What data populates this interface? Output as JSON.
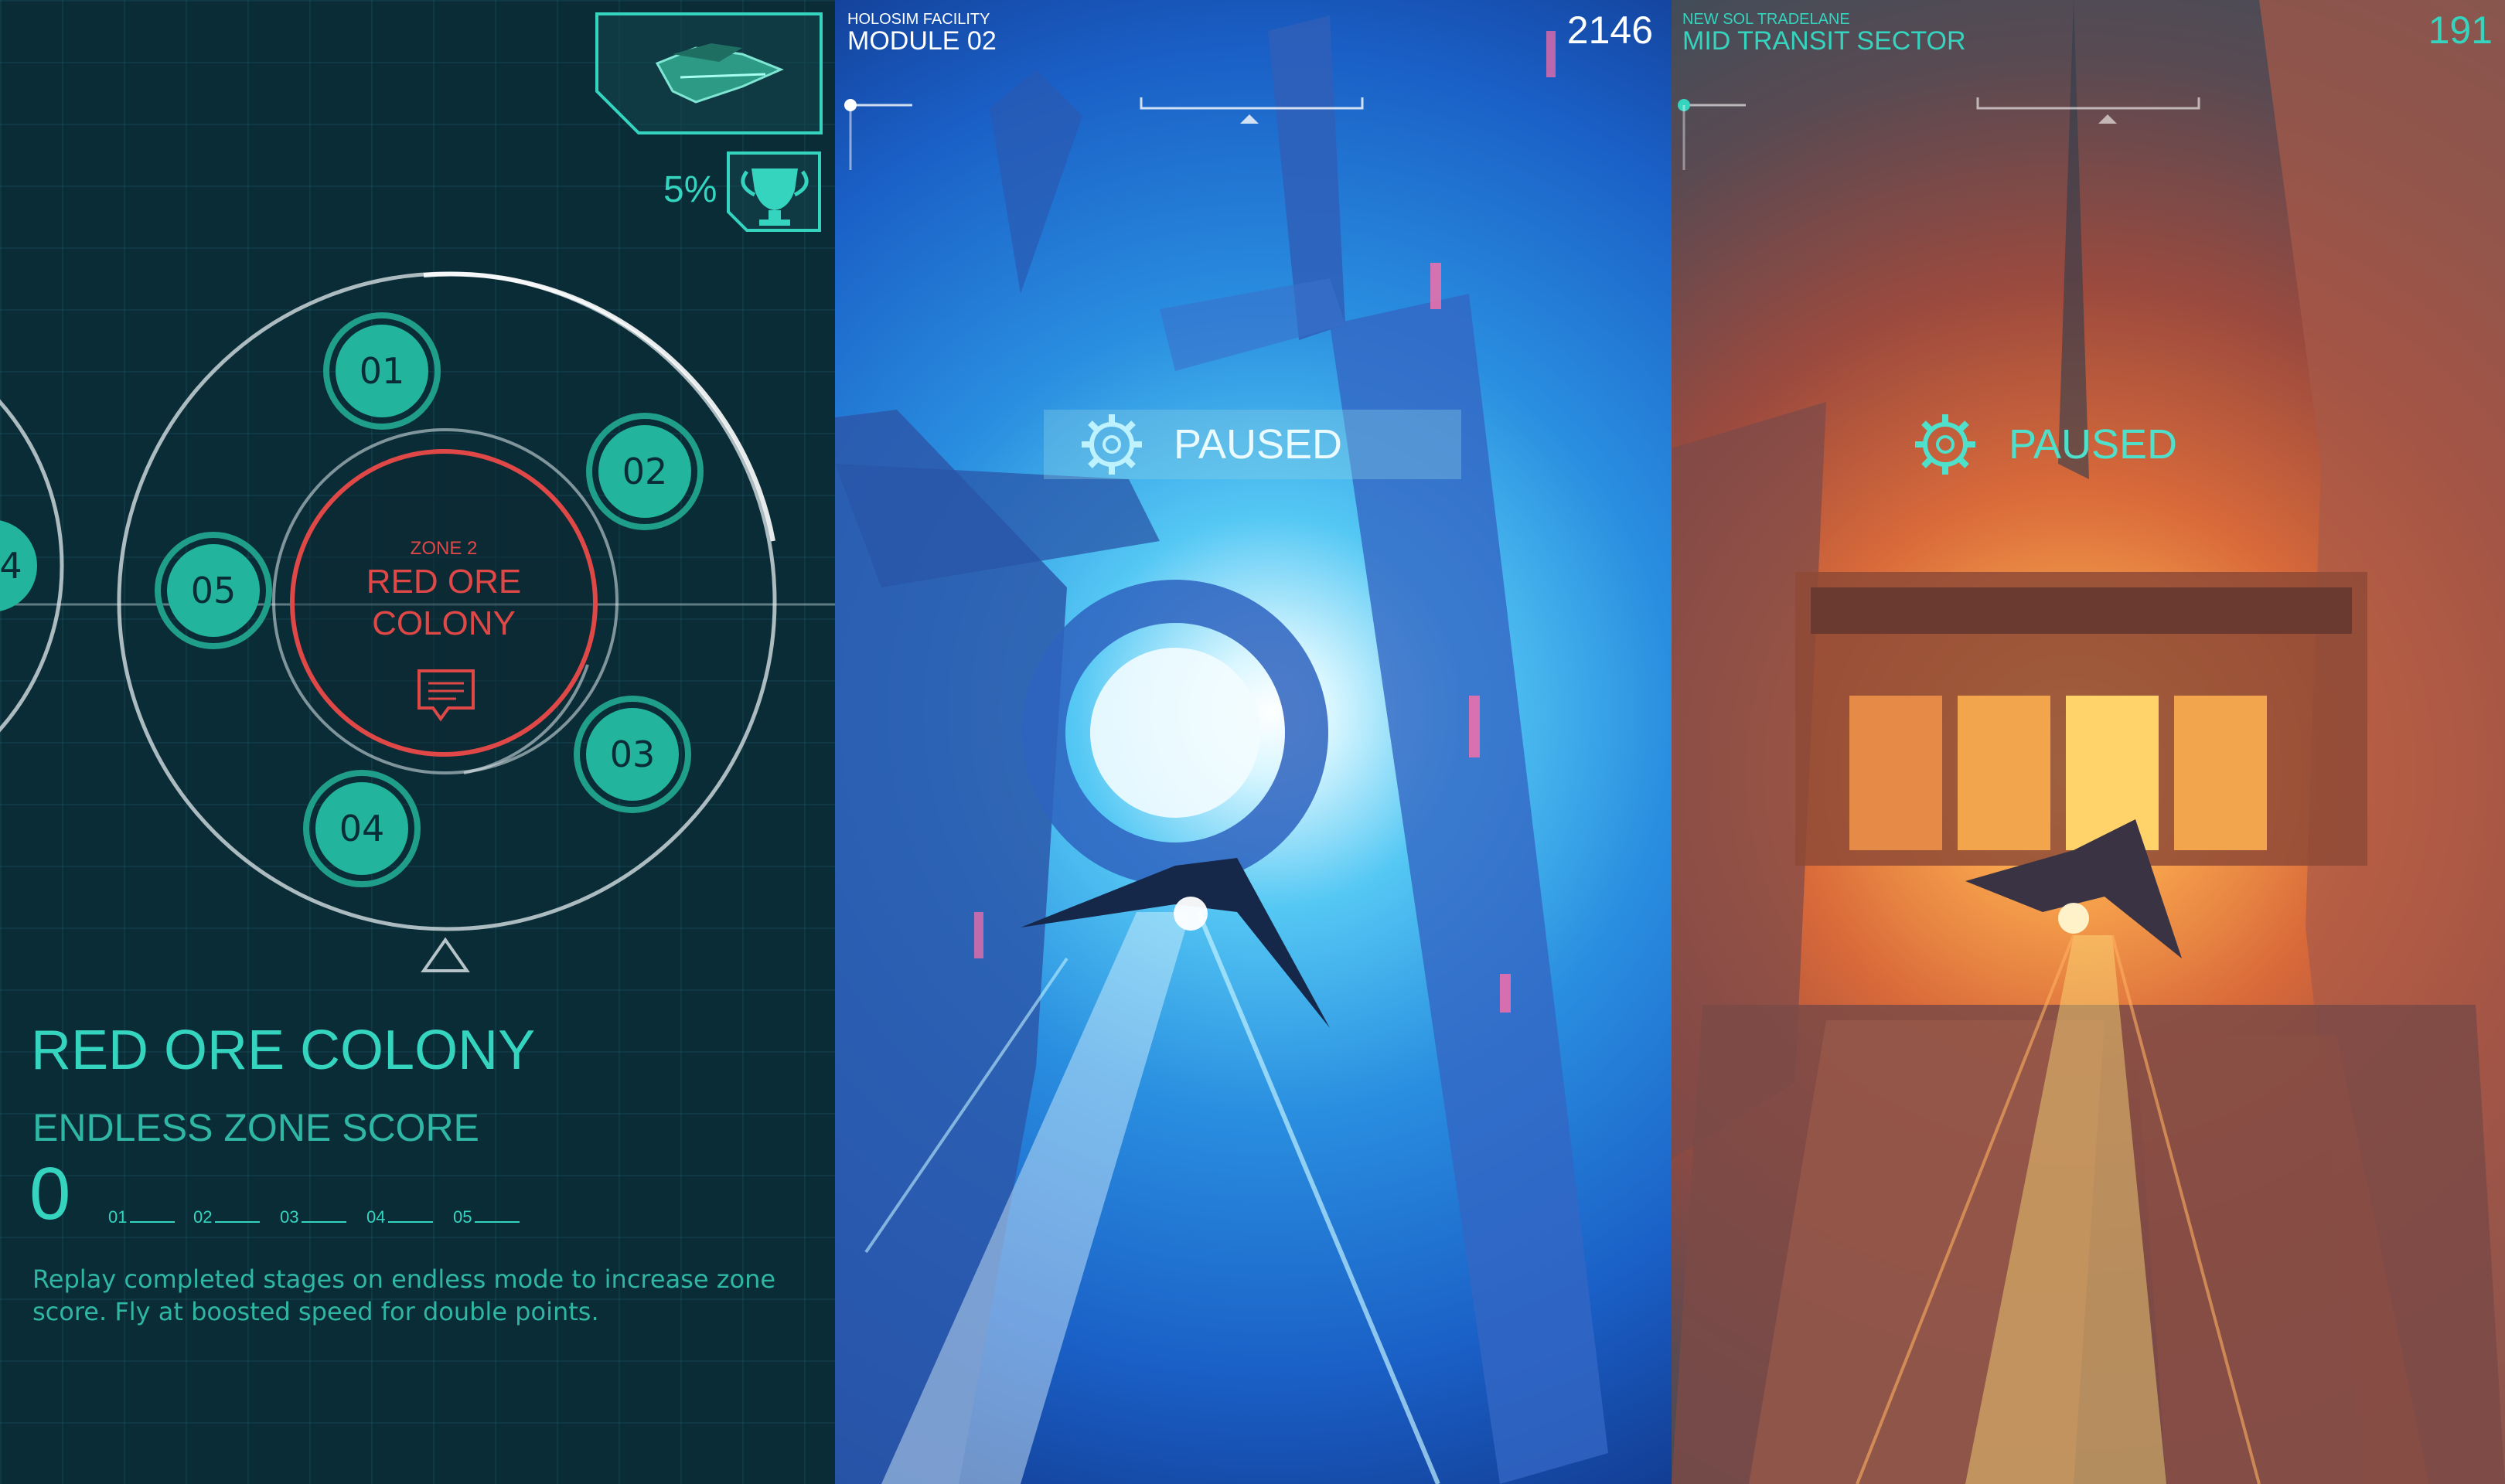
{
  "colors": {
    "teal": "#35d4bf",
    "red": "#e04848",
    "panel_bg": "#0a2c37",
    "sky_blue": "#2a8fe0",
    "sunset_orange": "#d96a3a"
  },
  "zone_map": {
    "completion": "5%",
    "zone_label": "ZONE 2",
    "zone_title_line1": "RED ORE",
    "zone_title_line2": "COLONY",
    "stages": [
      "01",
      "02",
      "03",
      "04",
      "05"
    ],
    "prev_stage": "4",
    "ship_icon": "ship-icon",
    "trophy_icon": "trophy-icon",
    "log_icon": "log-icon"
  },
  "zone_info": {
    "title": "RED ORE COLONY",
    "score_label": "ENDLESS ZONE SCORE",
    "score_value": "0",
    "stage_slots": [
      "01",
      "02",
      "03",
      "04",
      "05"
    ],
    "description_line1": "Replay completed stages on endless mode to increase zone",
    "description_line2": "score. Fly at boosted speed for double points."
  },
  "gameplay_blue": {
    "area_sub": "HOLOSIM FACILITY",
    "area_name": "MODULE 02",
    "score": "2146",
    "status": "PAUSED",
    "settings_icon": "gear-icon"
  },
  "gameplay_orange": {
    "area_sub": "NEW SOL TRADELANE",
    "area_name": "MID TRANSIT SECTOR",
    "score": "191",
    "status": "PAUSED",
    "settings_icon": "gear-icon"
  }
}
